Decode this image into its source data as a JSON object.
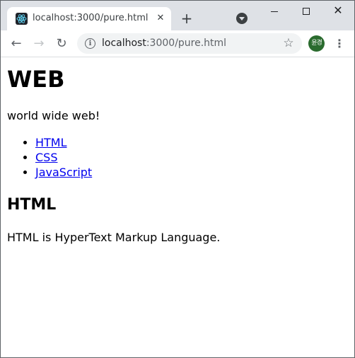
{
  "browser": {
    "tab": {
      "title": "localhost:3000/pure.html",
      "favicon": "react-logo-icon",
      "close_glyph": "✕"
    },
    "new_tab_glyph": "+",
    "window_controls": {
      "close_glyph": "✕"
    },
    "toolbar": {
      "back_glyph": "←",
      "forward_glyph": "→",
      "reload_glyph": "↻",
      "url_host": "localhost",
      "url_path": ":3000/pure.html",
      "info_glyph": "i",
      "star_glyph": "☆",
      "menu_glyph": "⋮",
      "profile_initials": "윤경",
      "profile_color": "#2a6b2e"
    }
  },
  "page": {
    "title": "WEB",
    "intro": "world wide web!",
    "links": [
      "HTML",
      "CSS",
      "JavaScript"
    ],
    "section_title": "HTML",
    "section_text": "HTML is HyperText Markup Language."
  },
  "colors": {
    "link": "#0000ee",
    "tab_strip": "#dee1e6",
    "omnibox": "#f1f3f4"
  }
}
